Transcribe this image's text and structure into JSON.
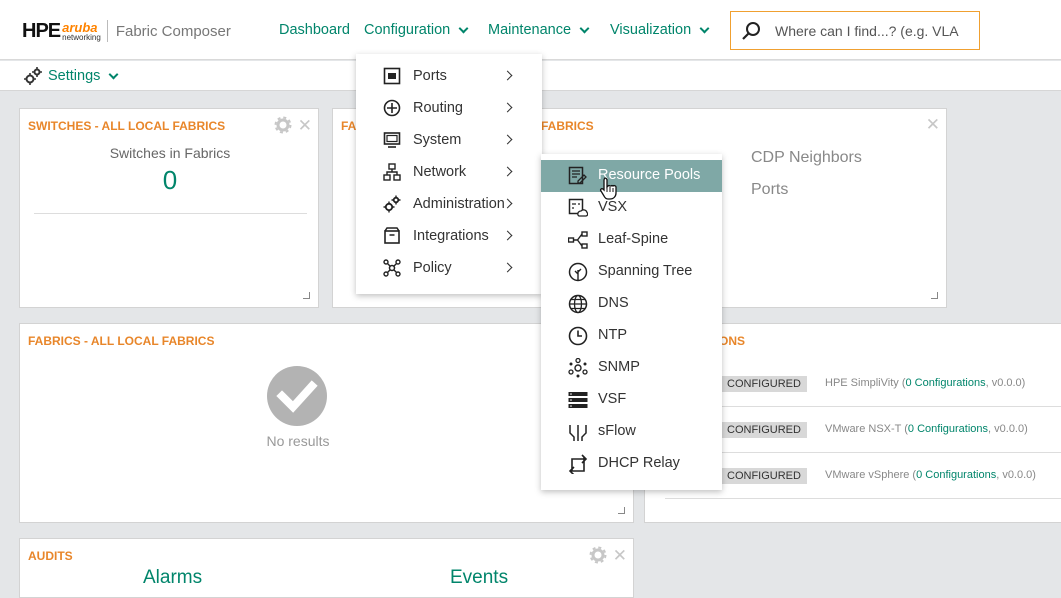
{
  "header": {
    "brand_hpe": "HPE",
    "brand_aruba": "aruba",
    "brand_networking": "networking",
    "app_name": "Fabric Composer",
    "nav": [
      "Dashboard",
      "Configuration",
      "Maintenance",
      "Visualization"
    ],
    "search_placeholder": "Where can I find...? (e.g. VLA"
  },
  "settings_label": "Settings",
  "panels": {
    "switches": {
      "title": "SWITCHES - ALL LOCAL FABRICS",
      "caption": "Switches in Fabrics",
      "value": "0"
    },
    "fabric_health": {
      "title_left": "FA",
      "title_right": "FABRICS",
      "links": [
        "CDP Neighbors",
        "Ports"
      ]
    },
    "fabrics": {
      "title": "FABRICS - ALL LOCAL FABRICS",
      "empty_text": "No results"
    },
    "integrations": {
      "title_suffix": "ONS",
      "rows": [
        {
          "badge": "CONFIGURED",
          "name": "HPE SimpliVity (",
          "link": "0 Configurations",
          "version": ", v0.0.0)"
        },
        {
          "badge": "CONFIGURED",
          "name": "VMware NSX-T (",
          "link": "0 Configurations",
          "version": ", v0.0.0)"
        },
        {
          "badge": "CONFIGURED",
          "name": "VMware vSphere (",
          "link": "0 Configurations",
          "version": ", v0.0.0)"
        }
      ]
    },
    "audits": {
      "title": "AUDITS",
      "col1": "Alarms",
      "col2": "Events"
    }
  },
  "config_menu": [
    {
      "label": "Ports",
      "icon": "ports-icon"
    },
    {
      "label": "Routing",
      "icon": "routing-icon"
    },
    {
      "label": "System",
      "icon": "system-icon"
    },
    {
      "label": "Network",
      "icon": "network-icon"
    },
    {
      "label": "Administration",
      "icon": "administration-icon"
    },
    {
      "label": "Integrations",
      "icon": "integrations-icon"
    },
    {
      "label": "Policy",
      "icon": "policy-icon"
    }
  ],
  "network_submenu": [
    {
      "label": "Resource Pools",
      "icon": "resource-pools-icon",
      "active": true
    },
    {
      "label": "VSX",
      "icon": "vsx-icon"
    },
    {
      "label": "Leaf-Spine",
      "icon": "leaf-spine-icon"
    },
    {
      "label": "Spanning Tree",
      "icon": "spanning-tree-icon"
    },
    {
      "label": "DNS",
      "icon": "dns-icon"
    },
    {
      "label": "NTP",
      "icon": "ntp-icon"
    },
    {
      "label": "SNMP",
      "icon": "snmp-icon"
    },
    {
      "label": "VSF",
      "icon": "vsf-icon"
    },
    {
      "label": "sFlow",
      "icon": "sflow-icon"
    },
    {
      "label": "DHCP Relay",
      "icon": "dhcp-relay-icon"
    }
  ],
  "colors": {
    "accent": "#01856b",
    "title_orange": "#e8862a",
    "active_item": "#7fa8a6"
  }
}
